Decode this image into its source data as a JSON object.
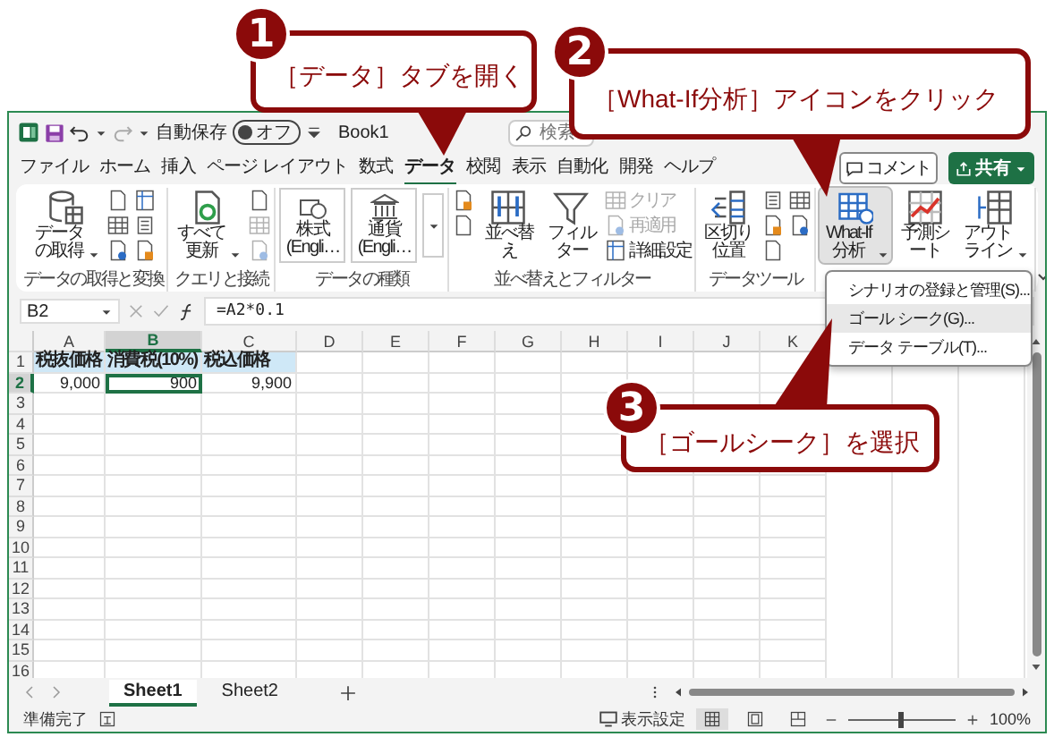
{
  "title_bar": {
    "autosave_label": "自動保存",
    "autosave": {
      "on": false,
      "label": "オフ"
    },
    "file_name": "Book1",
    "search": {
      "placeholder": "検索"
    }
  },
  "menu_tabs": [
    {
      "label": "ファイル",
      "selected": false
    },
    {
      "label": "ホーム",
      "selected": false
    },
    {
      "label": "挿入",
      "selected": false
    },
    {
      "label": "ページ レイアウト",
      "selected": false
    },
    {
      "label": "数式",
      "selected": false
    },
    {
      "label": "データ",
      "selected": true
    },
    {
      "label": "校閲",
      "selected": false
    },
    {
      "label": "表示",
      "selected": false
    },
    {
      "label": "自動化",
      "selected": false
    },
    {
      "label": "開発",
      "selected": false
    },
    {
      "label": "ヘルプ",
      "selected": false
    }
  ],
  "comment_button": "コメント",
  "share_button": "共有",
  "ribbon_groups": [
    {
      "label": "データの取得と変換",
      "items": [
        {
          "kind": "large",
          "label": "データの取得",
          "dropdown": true
        },
        {
          "kind": "icon"
        },
        {
          "kind": "icon"
        },
        {
          "kind": "icon"
        },
        {
          "kind": "icon"
        },
        {
          "kind": "icon"
        },
        {
          "kind": "icon"
        }
      ]
    },
    {
      "label": "クエリと接続",
      "items": [
        {
          "kind": "large",
          "label": "すべて更新",
          "dropdown": true
        },
        {
          "kind": "icon"
        },
        {
          "kind": "icon",
          "disabled": true
        },
        {
          "kind": "icon",
          "disabled": true
        }
      ]
    },
    {
      "label": "データの種類",
      "items": [
        {
          "kind": "wide",
          "label": "株式 (Engli…"
        },
        {
          "kind": "wide",
          "label": "通貨 (Engli…"
        },
        {
          "kind": "more"
        }
      ]
    },
    {
      "label": "並べ替えとフィルター",
      "items": [
        {
          "kind": "icon"
        },
        {
          "kind": "icon"
        },
        {
          "kind": "gap"
        },
        {
          "kind": "large",
          "label": "並べ替え"
        },
        {
          "kind": "large",
          "label": "フィルター"
        },
        {
          "kind": "small",
          "label": "クリア",
          "disabled": true
        },
        {
          "kind": "small",
          "label": "再適用",
          "disabled": true
        },
        {
          "kind": "small",
          "label": "詳細設定",
          "disabled": false
        }
      ]
    },
    {
      "label": "データツール",
      "items": [
        {
          "kind": "large",
          "label": "区切り位置"
        },
        {
          "kind": "icon"
        },
        {
          "kind": "icon"
        },
        {
          "kind": "icon"
        },
        {
          "kind": "icon"
        },
        {
          "kind": "icon"
        }
      ]
    },
    {
      "items": [
        {
          "kind": "large",
          "label": "What-If 分析",
          "dropdown": true,
          "selected": true
        },
        {
          "kind": "large",
          "label": "予測シート"
        },
        {
          "kind": "large",
          "label": "アウトライン",
          "dropdown": true
        }
      ]
    }
  ],
  "formula_bar": {
    "name_box": "B2",
    "formula": "=A2*0.1"
  },
  "columns": [
    {
      "label": "A",
      "selected": false
    },
    {
      "label": "B",
      "selected": true
    },
    {
      "label": "C",
      "selected": false
    },
    {
      "label": "D",
      "selected": false
    },
    {
      "label": "E",
      "selected": false
    },
    {
      "label": "F",
      "selected": false
    },
    {
      "label": "G",
      "selected": false
    },
    {
      "label": "H",
      "selected": false
    },
    {
      "label": "I",
      "selected": false
    },
    {
      "label": "J",
      "selected": false
    },
    {
      "label": "K",
      "selected": false
    }
  ],
  "rows": [
    {
      "number": "1",
      "selected": false,
      "cells": [
        {
          "text": "税抜価格",
          "kind": "heading",
          "selected": false
        },
        {
          "text": "消費税(10%)",
          "kind": "heading",
          "selected": false
        },
        {
          "text": "税込価格",
          "kind": "heading",
          "selected": false
        }
      ]
    },
    {
      "number": "2",
      "selected": true,
      "cells": [
        {
          "text": "9,000",
          "kind": "number",
          "selected": false
        },
        {
          "text": "900",
          "kind": "number",
          "selected": true
        },
        {
          "text": "9,900",
          "kind": "number",
          "selected": false
        }
      ]
    },
    {
      "number": "3",
      "selected": false
    },
    {
      "number": "4",
      "selected": false
    },
    {
      "number": "5",
      "selected": false
    },
    {
      "number": "6",
      "selected": false
    },
    {
      "number": "7",
      "selected": false
    },
    {
      "number": "8",
      "selected": false
    },
    {
      "number": "9",
      "selected": false
    },
    {
      "number": "10",
      "selected": false
    },
    {
      "number": "11",
      "selected": false
    },
    {
      "number": "12",
      "selected": false
    },
    {
      "number": "13",
      "selected": false
    },
    {
      "number": "14",
      "selected": false
    },
    {
      "number": "15",
      "selected": false
    },
    {
      "number": "16",
      "selected": false
    }
  ],
  "sheet_tabs": [
    {
      "label": "Sheet1",
      "selected": true
    },
    {
      "label": "Sheet2",
      "selected": false
    }
  ],
  "status_bar": {
    "status": "準備完了",
    "display_settings": "表示設定",
    "views": [
      {
        "selected": true
      },
      {
        "selected": false
      },
      {
        "selected": false
      }
    ],
    "zoom": {
      "level": 0.5,
      "reading": "100%"
    }
  },
  "dropdown_menu": [
    {
      "label": "シナリオの登録と管理(S)...",
      "selected": false
    },
    {
      "label": "ゴール シーク(G)...",
      "selected": true
    },
    {
      "label": "データ テーブル(T)...",
      "selected": false
    }
  ],
  "callouts": [
    {
      "number": "1",
      "text": "［データ］タブを開く"
    },
    {
      "number": "2",
      "text": "［What-If分析］アイコンをクリック"
    },
    {
      "number": "3",
      "text": "［ゴールシーク］を選択"
    }
  ]
}
